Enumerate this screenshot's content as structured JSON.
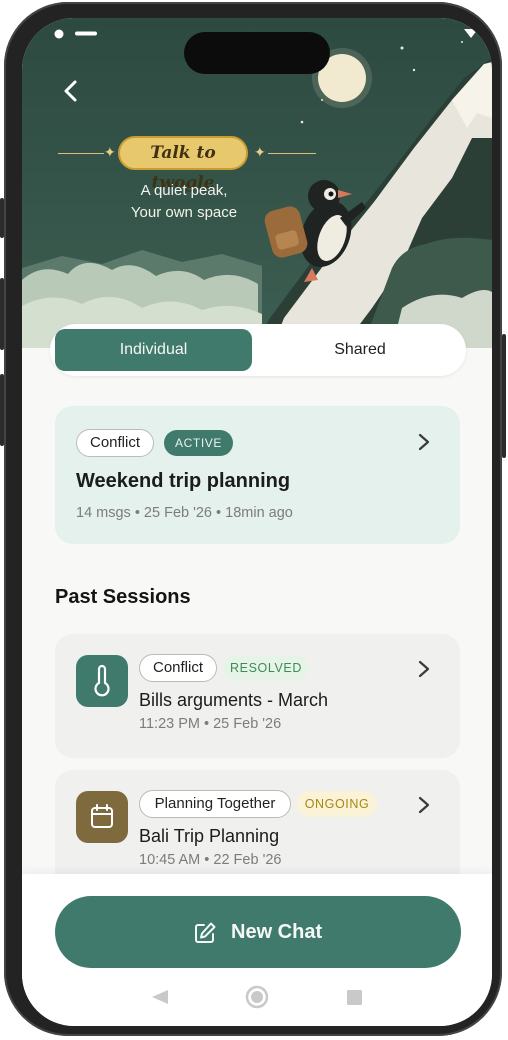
{
  "hero": {
    "brand": "Talk to twogle",
    "tagline_line1": "A quiet peak,",
    "tagline_line2": "Your own space"
  },
  "tabs": [
    "Individual",
    "Shared"
  ],
  "active_tab": "Individual",
  "active_session": {
    "tag": "Conflict",
    "status": "ACTIVE",
    "title": "Weekend trip planning",
    "meta": "14 msgs • 25 Feb '26 • 18min ago"
  },
  "past_sessions": {
    "heading": "Past Sessions",
    "items": [
      {
        "tag": "Conflict",
        "status": "RESOLVED",
        "title": "Bills arguments - March",
        "meta": "11:23 PM • 25 Feb '26",
        "icon": "thermometer-icon",
        "icon_color": "#3f7a6c",
        "status_color": "#3f8a5a",
        "status_bg": "#e6f4e8"
      },
      {
        "tag": "Planning Together",
        "status": "ONGOING",
        "title": "Bali Trip Planning",
        "meta": "10:45 AM • 22 Feb '26",
        "icon": "calendar-icon",
        "icon_color": "#7e6a3d",
        "status_color": "#a88614",
        "status_bg": "#fbf3d8"
      }
    ]
  },
  "new_chat_label": "New Chat",
  "colors": {
    "accent": "#3f7a6c",
    "active_card_bg": "#e4f1ec",
    "brand_gold": "#e7c86d"
  }
}
